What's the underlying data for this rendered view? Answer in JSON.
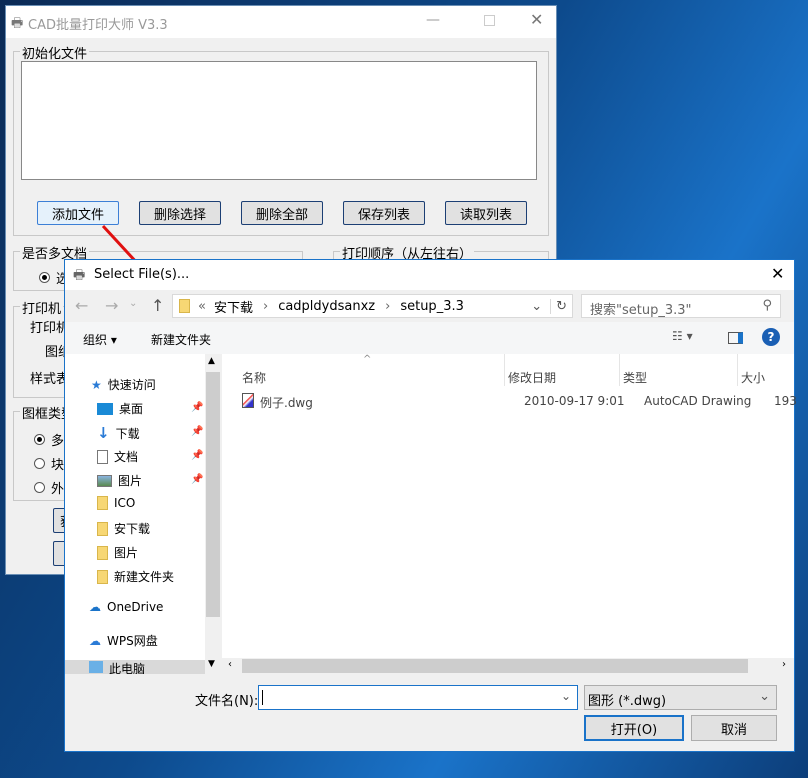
{
  "main_window": {
    "title": "CAD批量打印大师 V3.3",
    "init_group": "初始化文件",
    "buttons": [
      "添加文件",
      "删除选择",
      "删除全部",
      "保存列表",
      "读取列表"
    ],
    "multi_doc_group": "是否多文档",
    "multi_doc_option": "选",
    "print_order_group": "打印顺序（从左往右）",
    "printer_group": "打印机",
    "printer_label": "打印机",
    "paper_label": "图纸",
    "style_label": "样式表",
    "frame_group": "图框类型",
    "frame_options": [
      "多",
      "块",
      "外"
    ],
    "button_partial": "获"
  },
  "dialog": {
    "title": "Select File(s)...",
    "path": [
      "安下载",
      "cadpldydsanxz",
      "setup_3.3"
    ],
    "search_placeholder": "搜索\"setup_3.3\"",
    "organize": "组织",
    "new_folder": "新建文件夹",
    "nav": {
      "quick_access": "快速访问",
      "items": [
        "桌面",
        "下载",
        "文档",
        "图片",
        "ICO",
        "安下载",
        "图片",
        "新建文件夹"
      ],
      "onedrive": "OneDrive",
      "wps": "WPS网盘",
      "this_pc": "此电脑"
    },
    "columns": [
      "名称",
      "修改日期",
      "类型",
      "大小"
    ],
    "files": [
      {
        "name": "例子.dwg",
        "date": "2010-09-17 9:01",
        "type": "AutoCAD Drawing",
        "size": "193"
      }
    ],
    "filename_label": "文件名(N):",
    "filename_value": "",
    "filter": "图形 (*.dwg)",
    "open": "打开(O)",
    "cancel": "取消"
  },
  "colors": {
    "accent": "#1a73c9",
    "arrow": "#e01010"
  }
}
